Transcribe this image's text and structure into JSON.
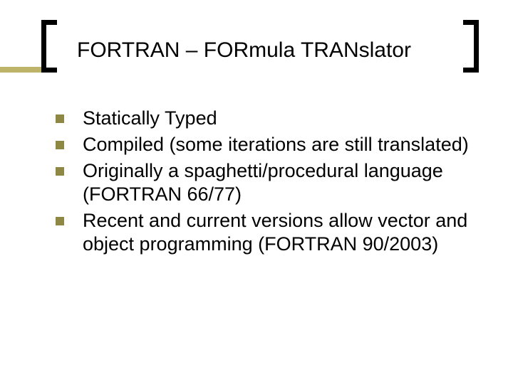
{
  "title": "FORTRAN – FORmula TRANslator",
  "bullets": [
    "Statically Typed",
    "Compiled (some iterations are still translated)",
    "Originally a spaghetti/procedural language (FORTRAN 66/77)",
    "Recent and current versions allow vector and object programming (FORTRAN 90/2003)"
  ]
}
